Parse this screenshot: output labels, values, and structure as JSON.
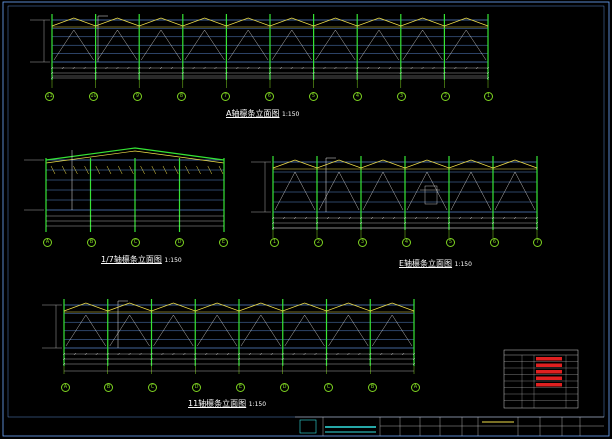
{
  "colors": {
    "background": "#000000",
    "frame": "#6fa8ff",
    "columns": "#35e535",
    "truss": "#f2e04a",
    "braces": "#e8e8e8",
    "axis": "#7ed321",
    "cyan": "#33e0e0",
    "dim": "#d0d0d0",
    "table_red": "#e02020"
  },
  "elevation_a": {
    "title": "A轴檩条立面图",
    "scale": "1:150",
    "axis_labels": [
      "11",
      "10",
      "9",
      "8",
      "7",
      "6",
      "5",
      "4",
      "3",
      "2",
      "1"
    ]
  },
  "elevation_1_7": {
    "title": "1/7轴檩条立面图",
    "scale": "1:150",
    "axis_labels": [
      "A",
      "B",
      "C",
      "D",
      "E"
    ]
  },
  "elevation_e": {
    "title": "E轴檩条立面图",
    "scale": "1:150",
    "axis_labels": [
      "1",
      "2",
      "3",
      "4",
      "5",
      "6",
      "7"
    ]
  },
  "elevation_11": {
    "title": "11轴檩条立面图",
    "scale": "1:150",
    "axis_labels": [
      "A",
      "B",
      "C",
      "D",
      "E",
      "D",
      "C",
      "B",
      "A"
    ]
  },
  "title_block": {
    "icon": "company-logo-icon"
  }
}
